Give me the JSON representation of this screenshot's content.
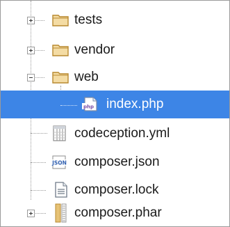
{
  "tree": {
    "items": [
      {
        "label": "tests",
        "icon": "folder-icon",
        "state": "collapsed"
      },
      {
        "label": "vendor",
        "icon": "folder-icon",
        "state": "collapsed"
      },
      {
        "label": "web",
        "icon": "folder-icon",
        "state": "expanded"
      },
      {
        "label": "index.php",
        "icon": "php-file-icon",
        "badge": "php",
        "selected": true
      },
      {
        "label": "codeception.yml",
        "icon": "yml-file-icon"
      },
      {
        "label": "composer.json",
        "icon": "json-file-icon",
        "badge": "JSON"
      },
      {
        "label": "composer.lock",
        "icon": "text-file-icon"
      },
      {
        "label": "composer.phar",
        "icon": "phar-archive-icon",
        "state": "collapsed"
      }
    ]
  },
  "colors": {
    "selection": "#3d85e6",
    "folder": "#d9b56a",
    "json_badge": "#2f5fb0"
  }
}
